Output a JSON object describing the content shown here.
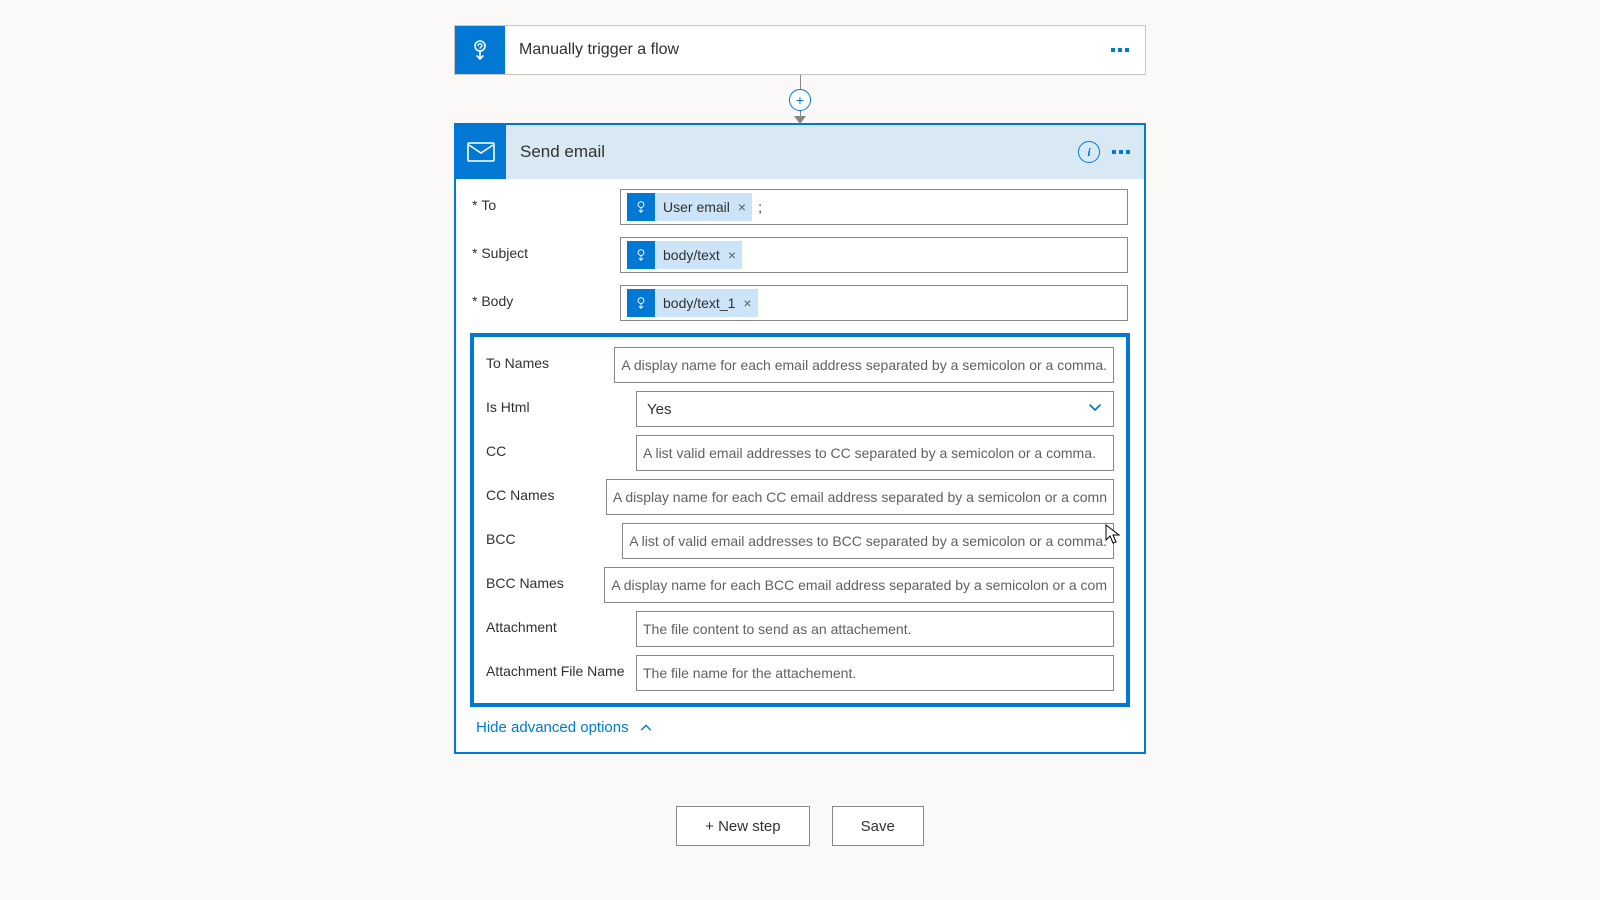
{
  "trigger": {
    "title": "Manually trigger a flow"
  },
  "action": {
    "title": "Send email"
  },
  "tokens": {
    "to": {
      "label": "User email",
      "remove": "×"
    },
    "subject": {
      "label": "body/text",
      "remove": "×"
    },
    "body": {
      "label": "body/text_1",
      "remove": "×"
    },
    "to_after": ";"
  },
  "labels": {
    "to": "To",
    "subject": "Subject",
    "body": "Body",
    "to_names": "To Names",
    "is_html": "Is Html",
    "cc": "CC",
    "cc_names": "CC Names",
    "bcc": "BCC",
    "bcc_names": "BCC Names",
    "attachment": "Attachment",
    "attachment_file": "Attachment File Name"
  },
  "placeholders": {
    "to_names": "A display name for each email address separated by a semicolon or a comma.",
    "cc": "A list valid email addresses to CC separated by a semicolon or a comma.",
    "cc_names": "A display name for each CC email address separated by a semicolon or a comn",
    "bcc": "A list of valid email addresses to BCC separated by a semicolon or a comma.",
    "bcc_names": "A display name for each BCC email address separated by a semicolon or a com",
    "attachment": "The file content to send as an attachement.",
    "attachment_file": "The file name for the attachement."
  },
  "is_html_value": "Yes",
  "hide_adv": "Hide advanced options",
  "buttons": {
    "new_step": "+ New step",
    "save": "Save"
  }
}
